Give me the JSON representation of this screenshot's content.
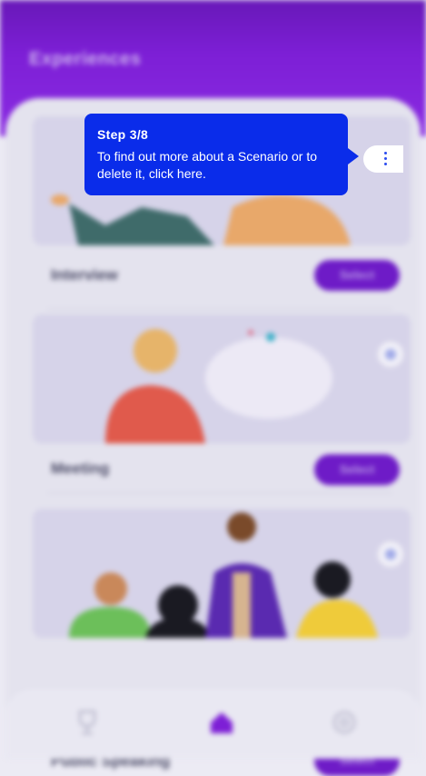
{
  "header": {
    "title": "Experiences"
  },
  "cards": [
    {
      "title": "Interview",
      "button_label": "Select"
    },
    {
      "title": "Meeting",
      "button_label": "Select"
    },
    {
      "title": "Public Speaking",
      "button_label": "Select"
    }
  ],
  "tooltip": {
    "step": "Step 3/8",
    "text": "To find out more about a Scenario or to delete it, click here."
  },
  "nav": [
    "trophy-icon",
    "home-icon",
    "settings-icon"
  ],
  "colors": {
    "primary": "#7d1fd6",
    "tooltip": "#0a2cea",
    "background": "#e4e3ee"
  }
}
